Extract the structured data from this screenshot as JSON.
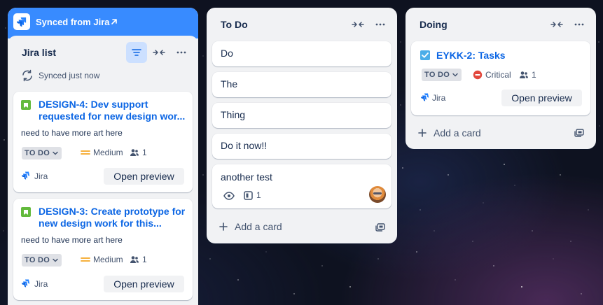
{
  "banner": {
    "title": "Synced from Jira"
  },
  "jira_list": {
    "title": "Jira list",
    "sync_status": "Synced just now",
    "cards": [
      {
        "key_title": "DESIGN-4: Dev support requested for new design wor...",
        "description": "need to have more art here",
        "status": "TO DO",
        "priority": "Medium",
        "assignees": "1",
        "source": "Jira",
        "action": "Open preview"
      },
      {
        "key_title": "DESIGN-3: Create prototype for new design work for this...",
        "description": "need to have more art here",
        "status": "TO DO",
        "priority": "Medium",
        "assignees": "1",
        "source": "Jira",
        "action": "Open preview"
      }
    ]
  },
  "todo_list": {
    "title": "To Do",
    "cards": [
      "Do",
      "The",
      "Thing",
      "Do it now!!"
    ],
    "rich_card": {
      "title": "another test",
      "attachments": "1"
    },
    "add_card": "Add a card"
  },
  "doing_list": {
    "title": "Doing",
    "card": {
      "key_title": "EYKK-2: Tasks",
      "status": "TO DO",
      "priority": "Critical",
      "assignees": "1",
      "source": "Jira",
      "action": "Open preview"
    },
    "add_card": "Add a card"
  },
  "colors": {
    "accent": "#0c66e4",
    "banner": "#388bff",
    "list_bg": "#f1f2f4",
    "medium": "#f5a623",
    "critical": "#e2483d",
    "story_green": "#63ba3c"
  }
}
